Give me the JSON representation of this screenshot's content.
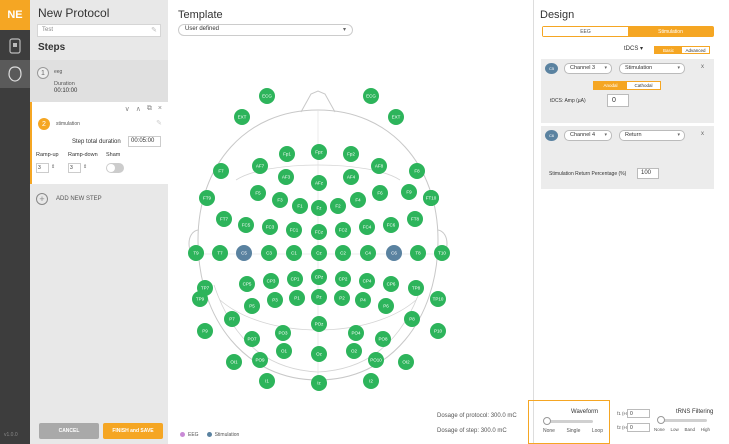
{
  "app": {
    "logo": "NE",
    "version": "v1.0.0"
  },
  "steps_panel": {
    "title": "New Protocol",
    "protocol_name": "Test",
    "steps_heading": "Steps",
    "step1": {
      "number": "1",
      "type": "eeg",
      "duration_label": "Duration",
      "duration_value": "00:10:00"
    },
    "step2": {
      "number": "2",
      "type": "stimulation",
      "step_total_duration_label": "Step total duration",
      "step_total_duration_value": "00:05:00",
      "ramp_up_label": "Ramp-up",
      "ramp_down_label": "Ramp-down",
      "sham_label": "Sham",
      "ramp_up_value": "3",
      "ramp_down_value": "3"
    },
    "add_step_label": "ADD NEW STEP",
    "cancel_label": "CANCEL",
    "finish_label": "FINISH and SAVE"
  },
  "template": {
    "title": "Template",
    "select_value": "User defined",
    "legend": [
      {
        "label": "EEG",
        "color": "#c98ad6"
      },
      {
        "label": "Stimulation",
        "color": "#5a82a0"
      }
    ],
    "dosage_protocol": "Dosage of protocol: 300.0 mC",
    "dosage_step": "Dosage of step: 300.0 mC",
    "colors": {
      "electrode": "#2db45b",
      "selected": "#5a82a0"
    },
    "electrodes": [
      {
        "label": "ECG",
        "state": "normal"
      },
      {
        "label": "ECG",
        "state": "normal"
      },
      {
        "label": "EXT",
        "state": "normal"
      },
      {
        "label": "EXT",
        "state": "normal"
      },
      {
        "label": "Fp1",
        "state": "normal"
      },
      {
        "label": "Fpz",
        "state": "normal"
      },
      {
        "label": "Fp2",
        "state": "normal"
      },
      {
        "label": "AF7",
        "state": "normal"
      },
      {
        "label": "AF3",
        "state": "normal"
      },
      {
        "label": "AFz",
        "state": "normal"
      },
      {
        "label": "AF4",
        "state": "normal"
      },
      {
        "label": "AF8",
        "state": "normal"
      },
      {
        "label": "F7",
        "state": "normal"
      },
      {
        "label": "F5",
        "state": "normal"
      },
      {
        "label": "F3",
        "state": "normal"
      },
      {
        "label": "F1",
        "state": "normal"
      },
      {
        "label": "Fz",
        "state": "normal"
      },
      {
        "label": "F2",
        "state": "normal"
      },
      {
        "label": "F4",
        "state": "normal"
      },
      {
        "label": "F6",
        "state": "normal"
      },
      {
        "label": "F8",
        "state": "normal"
      },
      {
        "label": "F9",
        "state": "normal"
      },
      {
        "label": "F10",
        "state": "normal"
      },
      {
        "label": "FT9",
        "state": "normal"
      },
      {
        "label": "FT10",
        "state": "normal"
      },
      {
        "label": "FT7",
        "state": "normal"
      },
      {
        "label": "FC5",
        "state": "normal"
      },
      {
        "label": "FC3",
        "state": "normal"
      },
      {
        "label": "FC1",
        "state": "normal"
      },
      {
        "label": "FCz",
        "state": "normal"
      },
      {
        "label": "FC2",
        "state": "normal"
      },
      {
        "label": "FC4",
        "state": "normal"
      },
      {
        "label": "FC6",
        "state": "normal"
      },
      {
        "label": "FT8",
        "state": "normal"
      },
      {
        "label": "T9",
        "state": "normal"
      },
      {
        "label": "T7",
        "state": "normal"
      },
      {
        "label": "C5",
        "state": "selected"
      },
      {
        "label": "C3",
        "state": "normal"
      },
      {
        "label": "C1",
        "state": "normal"
      },
      {
        "label": "Cz",
        "state": "normal"
      },
      {
        "label": "C2",
        "state": "normal"
      },
      {
        "label": "C4",
        "state": "normal"
      },
      {
        "label": "C6",
        "state": "selected"
      },
      {
        "label": "T8",
        "state": "normal"
      },
      {
        "label": "T10",
        "state": "normal"
      },
      {
        "label": "TP9",
        "state": "normal"
      },
      {
        "label": "TP7",
        "state": "normal"
      },
      {
        "label": "CP5",
        "state": "normal"
      },
      {
        "label": "CP3",
        "state": "normal"
      },
      {
        "label": "CP1",
        "state": "normal"
      },
      {
        "label": "CPz",
        "state": "normal"
      },
      {
        "label": "CP2",
        "state": "normal"
      },
      {
        "label": "CP4",
        "state": "normal"
      },
      {
        "label": "CP6",
        "state": "normal"
      },
      {
        "label": "TP8",
        "state": "normal"
      },
      {
        "label": "TP10",
        "state": "normal"
      },
      {
        "label": "P7",
        "state": "normal"
      },
      {
        "label": "P5",
        "state": "normal"
      },
      {
        "label": "P3",
        "state": "normal"
      },
      {
        "label": "P1",
        "state": "normal"
      },
      {
        "label": "Pz",
        "state": "normal"
      },
      {
        "label": "P2",
        "state": "normal"
      },
      {
        "label": "P4",
        "state": "normal"
      },
      {
        "label": "P6",
        "state": "normal"
      },
      {
        "label": "P8",
        "state": "normal"
      },
      {
        "label": "P9",
        "state": "normal"
      },
      {
        "label": "P10",
        "state": "normal"
      },
      {
        "label": "PO7",
        "state": "normal"
      },
      {
        "label": "PO3",
        "state": "normal"
      },
      {
        "label": "POz",
        "state": "normal"
      },
      {
        "label": "PO4",
        "state": "normal"
      },
      {
        "label": "PO8",
        "state": "normal"
      },
      {
        "label": "PO9",
        "state": "normal"
      },
      {
        "label": "PO10",
        "state": "normal"
      },
      {
        "label": "O1",
        "state": "normal"
      },
      {
        "label": "Oz",
        "state": "normal"
      },
      {
        "label": "O2",
        "state": "normal"
      },
      {
        "label": "I1",
        "state": "normal"
      },
      {
        "label": "Iz",
        "state": "normal"
      },
      {
        "label": "I2",
        "state": "normal"
      },
      {
        "label": "OI1",
        "state": "normal"
      },
      {
        "label": "OI2",
        "state": "normal"
      }
    ]
  },
  "design": {
    "title": "Design",
    "tabs": [
      {
        "label": "EEG",
        "active": false
      },
      {
        "label": "Stimulation",
        "active": true
      }
    ],
    "mode_select": "tDCS",
    "mode_tabs": [
      {
        "label": "Basic",
        "active": true
      },
      {
        "label": "Advanced",
        "active": false
      }
    ],
    "ch1": {
      "tag": "C5",
      "channel": "Channel 3",
      "type": "Stimulation",
      "close": "x",
      "polarity": [
        {
          "label": "Anodal",
          "active": true
        },
        {
          "label": "Cathodal",
          "active": false
        }
      ],
      "amp_label": "tDCS:   Amp (µA)",
      "amp_value": "0"
    },
    "ch2": {
      "tag": "C6",
      "channel": "Channel 4",
      "type": "Return",
      "close": "x",
      "srp_label": "Stimulation Return Percentage (%)",
      "srp_value": "100"
    },
    "waveform": {
      "title": "Waveform",
      "options": [
        "None",
        "Single",
        "Loop"
      ]
    },
    "filters": {
      "f1_label": "f1 (Hz)",
      "f1_value": "0",
      "f2_label": "f2 (Hz)",
      "f2_value": "0"
    },
    "trns": {
      "title": "tRNS Filtering",
      "options": [
        "None",
        "Low",
        "Band",
        "High"
      ]
    }
  }
}
